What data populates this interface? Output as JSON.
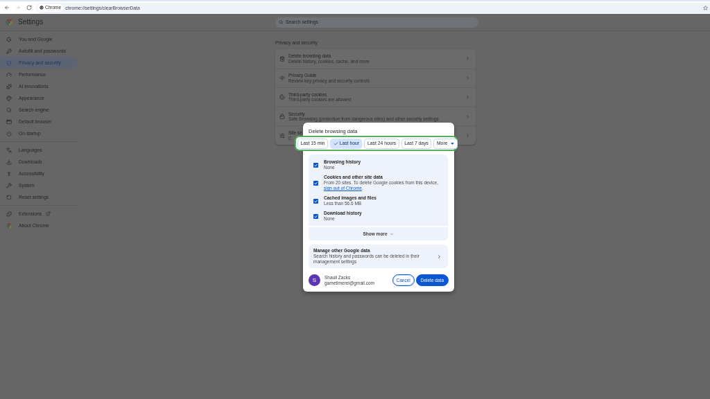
{
  "browser": {
    "nav": [
      {
        "kind": "back",
        "disabled": false
      },
      {
        "kind": "forward",
        "disabled": true
      },
      {
        "kind": "reload",
        "disabled": false
      }
    ],
    "site_chip": "Chrome",
    "url": "chrome://settings/clearBrowserData"
  },
  "header": {
    "title": "Settings",
    "search_placeholder": "Search settings"
  },
  "sidebar": {
    "groups": [
      {
        "items": [
          {
            "label": "You and Google",
            "selected": false,
            "external": false
          },
          {
            "label": "Autofill and passwords",
            "selected": false,
            "external": false
          },
          {
            "label": "Privacy and security",
            "selected": true,
            "external": false
          },
          {
            "label": "Performance",
            "selected": false,
            "external": false
          },
          {
            "label": "AI innovations",
            "selected": false,
            "external": false
          },
          {
            "label": "Appearance",
            "selected": false,
            "external": false
          },
          {
            "label": "Search engine",
            "selected": false,
            "external": false
          },
          {
            "label": "Default browser",
            "selected": false,
            "external": false
          },
          {
            "label": "On startup",
            "selected": false,
            "external": false
          }
        ]
      },
      {
        "items": [
          {
            "label": "Languages",
            "selected": false,
            "external": false
          },
          {
            "label": "Downloads",
            "selected": false,
            "external": false
          },
          {
            "label": "Accessibility",
            "selected": false,
            "external": false
          },
          {
            "label": "System",
            "selected": false,
            "external": false
          },
          {
            "label": "Reset settings",
            "selected": false,
            "external": false
          }
        ]
      },
      {
        "items": [
          {
            "label": "Extensions",
            "selected": false,
            "external": true
          },
          {
            "label": "About Chrome",
            "selected": false,
            "external": false
          }
        ]
      }
    ]
  },
  "main": {
    "heading": "Privacy and security",
    "rows": [
      {
        "title": "Delete browsing data",
        "subtitle": "Delete history, cookies, cache, and more"
      },
      {
        "title": "Privacy Guide",
        "subtitle": "Review key privacy and security controls"
      },
      {
        "title": "Third-party cookies",
        "subtitle": "Third-party cookies are allowed"
      },
      {
        "title": "Security",
        "subtitle": "Safe Browsing (protection from dangerous sites) and other security settings"
      },
      {
        "title": "Site se",
        "subtitle": "C"
      }
    ]
  },
  "dialog": {
    "title": "Delete browsing data",
    "time_ranges": [
      {
        "label": "Last 15 min",
        "kind": "option",
        "selected": false
      },
      {
        "label": "Last hour",
        "kind": "option",
        "selected": true
      },
      {
        "label": "Last 24 hours",
        "kind": "option",
        "selected": false
      },
      {
        "label": "Last 7 days",
        "kind": "option",
        "selected": false
      },
      {
        "label": "More",
        "kind": "menu",
        "selected": false
      }
    ],
    "data_types": [
      {
        "title": "Browsing history",
        "description": "None",
        "checked": true
      },
      {
        "title": "Cookies and other site data",
        "description": "From 20 sites. To delete Google cookies from this device, ",
        "link": "sign out of Chrome",
        "after_link": ".",
        "checked": true
      },
      {
        "title": "Cached images and files",
        "description": "Less than 56.6 MB",
        "checked": true
      },
      {
        "title": "Download history",
        "description": "None",
        "checked": true
      }
    ],
    "show_more": "Show more",
    "manage": {
      "title": "Manage other Google data",
      "description": "Search history and passwords can be deleted in their management settings"
    },
    "account": {
      "initial": "S",
      "name": "Shauli Zacks",
      "email": "gametimerel@gmail.com"
    },
    "buttons": [
      {
        "label": "Cancel",
        "kind": "secondary",
        "focused": true
      },
      {
        "label": "Delete data",
        "kind": "primary",
        "focused": false
      }
    ]
  }
}
